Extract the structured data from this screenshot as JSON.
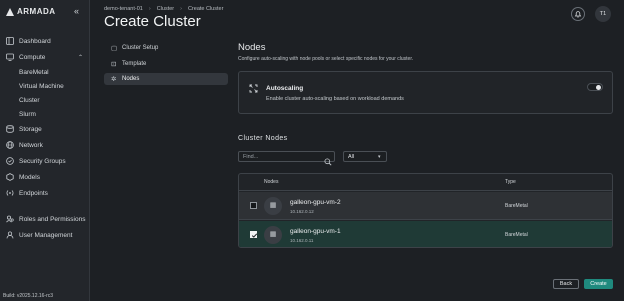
{
  "app": {
    "logo": "ARMADA",
    "build": "Build: v2025.12.16-rc3"
  },
  "sidebar": {
    "items": [
      {
        "label": "Dashboard",
        "icon": "dashboard-icon",
        "sub": false
      },
      {
        "label": "Compute",
        "icon": "compute-icon",
        "sub": false,
        "expanded": true
      },
      {
        "label": "BareMetal",
        "sub": true
      },
      {
        "label": "Virtual Machine",
        "sub": true
      },
      {
        "label": "Cluster",
        "sub": true
      },
      {
        "label": "Slurm",
        "sub": true
      },
      {
        "label": "Storage",
        "icon": "storage-icon",
        "sub": false
      },
      {
        "label": "Network",
        "icon": "network-icon",
        "sub": false
      },
      {
        "label": "Security Groups",
        "icon": "security-icon",
        "sub": false
      },
      {
        "label": "Models",
        "icon": "models-icon",
        "sub": false
      },
      {
        "label": "Endpoints",
        "icon": "endpoints-icon",
        "sub": false
      },
      {
        "label": "Roles and Permissions",
        "icon": "roles-icon",
        "sub": false
      },
      {
        "label": "User Management",
        "icon": "user-icon",
        "sub": false
      }
    ]
  },
  "header": {
    "breadcrumb": [
      "demo-tenant-01",
      "Cluster",
      "Create Cluster"
    ],
    "title": "Create Cluster",
    "avatar": "T1"
  },
  "steps": [
    {
      "label": "Cluster Setup",
      "icon": "setup-icon"
    },
    {
      "label": "Template",
      "icon": "template-icon"
    },
    {
      "label": "Nodes",
      "icon": "nodes-icon",
      "active": true
    }
  ],
  "nodes_section": {
    "title": "Nodes",
    "description": "Configure auto-scaling with node pools or select specific nodes for your cluster.",
    "autoscaling": {
      "title": "Autoscaling",
      "description": "Enable cluster auto-scaling based on workload demands",
      "enabled": false
    },
    "cluster_nodes_title": "Cluster Nodes",
    "search": {
      "placeholder": "Find...",
      "value": ""
    },
    "filter": {
      "selected": "All"
    },
    "table": {
      "columns": [
        "Nodes",
        "Type"
      ],
      "rows": [
        {
          "name": "galleon-gpu-vm-2",
          "ip": "10.162.0.12",
          "type": "BareMetal",
          "selected": false
        },
        {
          "name": "galleon-gpu-vm-1",
          "ip": "10.162.0.11",
          "type": "BareMetal",
          "selected": true
        }
      ]
    }
  },
  "actions": {
    "back": "Back",
    "create": "Create"
  },
  "colors": {
    "accent": "#1f8a7e",
    "background": "#1d2024",
    "selected_row": "#1f3a36"
  }
}
